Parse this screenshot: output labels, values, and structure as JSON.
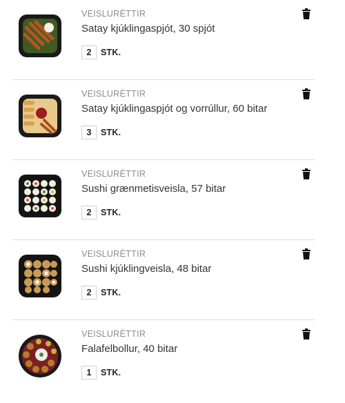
{
  "cart": {
    "items": [
      {
        "category": "VEISLURÉTTIR",
        "title": "Satay kjúklingaspjót, 30 spjót",
        "quantity": "2",
        "unit": "STK."
      },
      {
        "category": "VEISLURÉTTIR",
        "title": "Satay kjúklingaspjót og vorrúllur, 60 bitar",
        "quantity": "3",
        "unit": "STK."
      },
      {
        "category": "VEISLURÉTTIR",
        "title": "Sushi grænmetisveisla, 57 bitar",
        "quantity": "2",
        "unit": "STK."
      },
      {
        "category": "VEISLURÉTTIR",
        "title": "Sushi kjúklingveisla, 48 bitar",
        "quantity": "2",
        "unit": "STK."
      },
      {
        "category": "VEISLURÉTTIR",
        "title": "Falafelbollur, 40 bitar",
        "quantity": "1",
        "unit": "STK."
      }
    ]
  },
  "icons": {
    "delete": "trash-icon"
  },
  "colors": {
    "divider": "#dcdcdc",
    "category_text": "#8a8a8a",
    "title_text": "#333333"
  }
}
